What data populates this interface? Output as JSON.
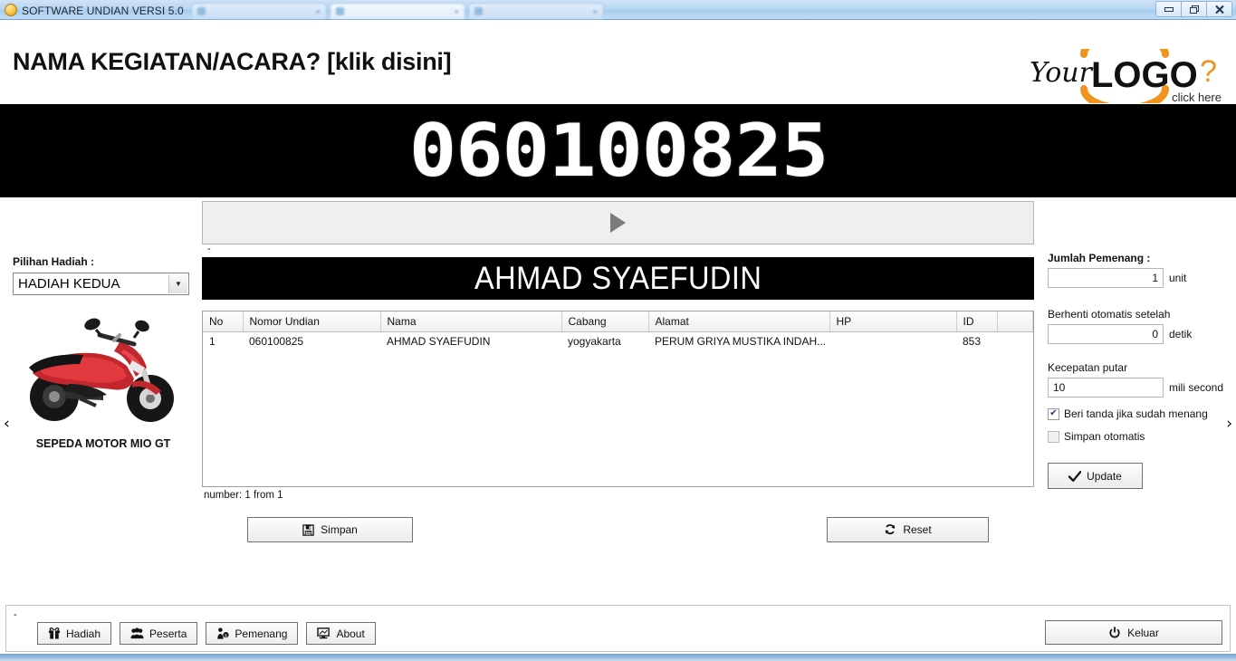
{
  "window": {
    "app_title": "SOFTWARE UNDIAN VERSI 5.0",
    "app_icon": "app-circle-icon",
    "minimize": "–",
    "restore": "❐",
    "close": "✕",
    "tabs": [
      {
        "label": ""
      },
      {
        "label": ""
      },
      {
        "label": ""
      }
    ]
  },
  "header": {
    "title": "NAMA KEGIATAN/ACARA? [klik disini]",
    "logo": {
      "your": "Your",
      "logo": "LOGO",
      "question": "?",
      "click_here": "click here",
      "accent_color": "#f0941e"
    }
  },
  "marquee": {
    "number": "060100825"
  },
  "nav": {
    "prev": "‹",
    "next": "›"
  },
  "left": {
    "prize_label": "Pilihan Hadiah :",
    "prize_selected": "HADIAH KEDUA",
    "prize_options": [
      "HADIAH KEDUA"
    ],
    "dropdown_icon": "chevron-down-icon",
    "prize_image": "motorcycle-image",
    "prize_caption": "SEPEDA MOTOR MIO GT"
  },
  "center": {
    "play_icon": "play-triangle-icon",
    "dash_label": "-",
    "winner_name": "AHMAD SYAEFUDIN",
    "table": {
      "columns": [
        "No",
        "Nomor Undian",
        "Nama",
        "Cabang",
        "Alamat",
        "HP",
        "ID",
        ""
      ],
      "rows": [
        {
          "no": "1",
          "nomor_undian": "060100825",
          "nama": "AHMAD SYAEFUDIN",
          "cabang": "yogyakarta",
          "alamat": "PERUM GRIYA MUSTIKA INDAH...",
          "hp": "",
          "id": "853",
          "extra": ""
        }
      ]
    },
    "status": "number: 1 from 1",
    "save_label": "Simpan",
    "save_icon": "floppy-disk-icon",
    "reset_label": "Reset",
    "reset_icon": "refresh-icon"
  },
  "right": {
    "winners_label": "Jumlah Pemenang :",
    "winners_value": "1",
    "winners_unit": "unit",
    "autostop_label": "Berhenti otomatis setelah",
    "autostop_value": "0",
    "autostop_unit": "detik",
    "speed_label": "Kecepatan putar",
    "speed_value": "10",
    "speed_unit": "mili second",
    "mark_winner_label": "Beri tanda jika sudah menang",
    "mark_winner_checked": true,
    "autosave_label": "Simpan otomatis",
    "autosave_checked": false,
    "update_label": "Update",
    "update_icon": "check-icon"
  },
  "footer": {
    "dash_label": "-",
    "buttons": [
      {
        "label": "Hadiah",
        "icon": "gift-icon"
      },
      {
        "label": "Peserta",
        "icon": "people-icon"
      },
      {
        "label": "Pemenang",
        "icon": "person-money-icon"
      },
      {
        "label": "About",
        "icon": "monitor-icon"
      }
    ],
    "exit_label": "Keluar",
    "exit_icon": "power-icon"
  }
}
